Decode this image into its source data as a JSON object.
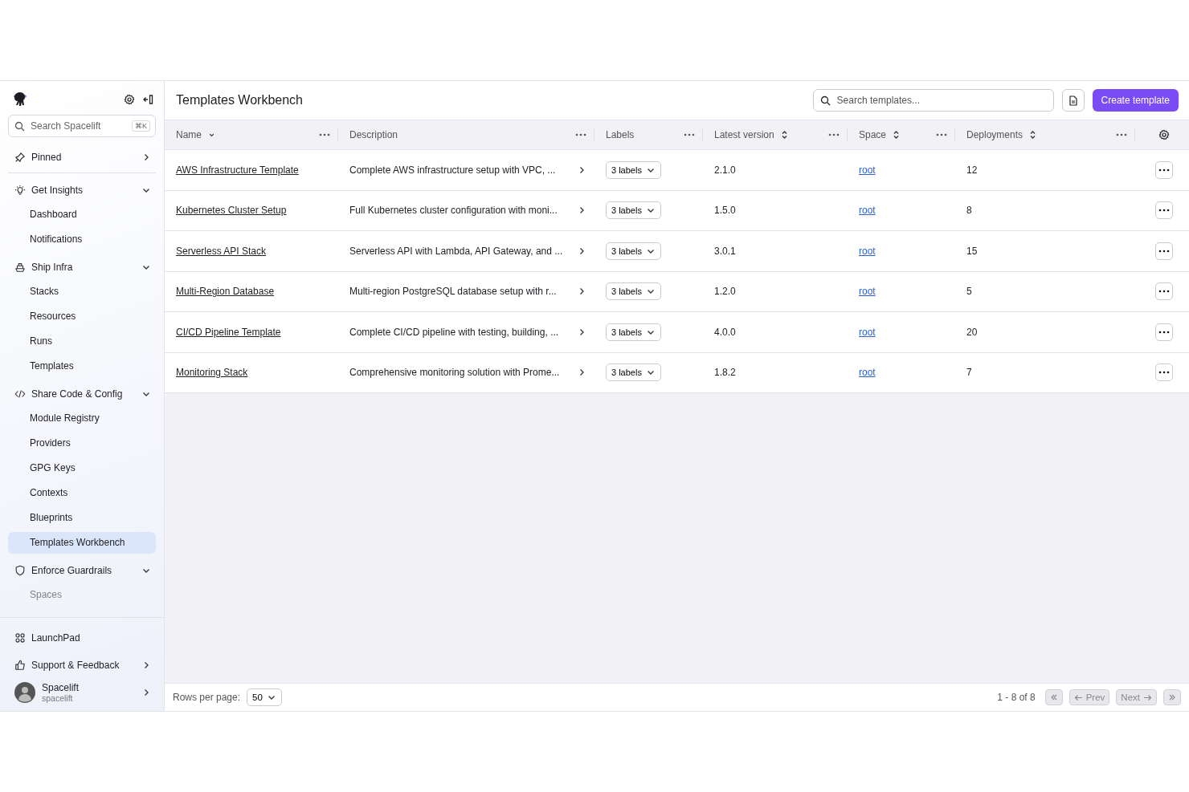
{
  "sidebar": {
    "search": {
      "placeholder": "Search Spacelift",
      "shortcut": "⌘K"
    },
    "sections": [
      {
        "label": "Pinned",
        "expanded": false
      },
      {
        "label": "Get Insights",
        "expanded": true,
        "items": [
          {
            "label": "Dashboard",
            "selected": false
          },
          {
            "label": "Notifications",
            "selected": false
          }
        ]
      },
      {
        "label": "Ship Infra",
        "expanded": true,
        "items": [
          {
            "label": "Stacks",
            "selected": false
          },
          {
            "label": "Resources",
            "selected": false
          },
          {
            "label": "Runs",
            "selected": false
          },
          {
            "label": "Templates",
            "selected": false
          }
        ]
      },
      {
        "label": "Share Code & Config",
        "expanded": true,
        "items": [
          {
            "label": "Module Registry",
            "selected": false
          },
          {
            "label": "Providers",
            "selected": false
          },
          {
            "label": "GPG Keys",
            "selected": false
          },
          {
            "label": "Contexts",
            "selected": false
          },
          {
            "label": "Blueprints",
            "selected": false
          },
          {
            "label": "Templates Workbench",
            "selected": true
          }
        ]
      },
      {
        "label": "Enforce Guardrails",
        "expanded": true,
        "items": [
          {
            "label": "Spaces",
            "selected": false
          }
        ]
      }
    ],
    "bottom": [
      {
        "label": "LaunchPad",
        "has_submenu": false
      },
      {
        "label": "Support & Feedback",
        "has_submenu": true
      }
    ],
    "user": {
      "name": "Spacelift",
      "handle": "spacelift"
    }
  },
  "header": {
    "title": "Templates Workbench",
    "search": {
      "placeholder": "Search templates..."
    },
    "create_button": "Create template"
  },
  "table": {
    "columns": [
      {
        "label": "Name",
        "kind": "sorted"
      },
      {
        "label": "Description",
        "kind": "plain"
      },
      {
        "label": "Labels",
        "kind": "plain"
      },
      {
        "label": "Latest version",
        "kind": "sortable"
      },
      {
        "label": "Space",
        "kind": "sortable"
      },
      {
        "label": "Deployments",
        "kind": "sortable"
      }
    ],
    "rows": [
      {
        "name": "AWS Infrastructure Template",
        "description": "Complete AWS infrastructure setup with VPC, ...",
        "labels": "3 labels",
        "version": "2.1.0",
        "space": "root",
        "deployments": "12"
      },
      {
        "name": "Kubernetes Cluster Setup",
        "description": "Full Kubernetes cluster configuration with moni...",
        "labels": "3 labels",
        "version": "1.5.0",
        "space": "root",
        "deployments": "8"
      },
      {
        "name": "Serverless API Stack",
        "description": "Serverless API with Lambda, API Gateway, and ...",
        "labels": "3 labels",
        "version": "3.0.1",
        "space": "root",
        "deployments": "15"
      },
      {
        "name": "Multi-Region Database",
        "description": "Multi-region PostgreSQL database setup with r...",
        "labels": "3 labels",
        "version": "1.2.0",
        "space": "root",
        "deployments": "5"
      },
      {
        "name": "CI/CD Pipeline Template",
        "description": "Complete CI/CD pipeline with testing, building, ...",
        "labels": "3 labels",
        "version": "4.0.0",
        "space": "root",
        "deployments": "20"
      },
      {
        "name": "Monitoring Stack",
        "description": "Comprehensive monitoring solution with Prome...",
        "labels": "3 labels",
        "version": "1.8.2",
        "space": "root",
        "deployments": "7"
      }
    ]
  },
  "footer": {
    "rows_per_page_label": "Rows per page:",
    "rows_per_page": "50",
    "range": "1 - 8 of 8",
    "pager": [
      {
        "kind": "first",
        "disabled": true
      },
      {
        "kind": "prev",
        "label": "Prev",
        "disabled": true
      },
      {
        "kind": "next",
        "label": "Next",
        "disabled": true
      },
      {
        "kind": "last",
        "disabled": true
      }
    ]
  }
}
